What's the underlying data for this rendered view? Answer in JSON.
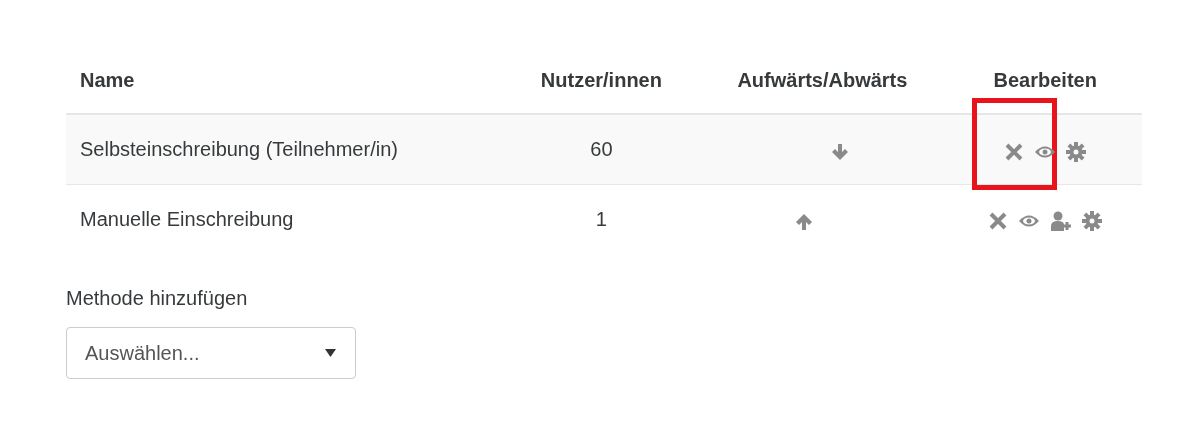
{
  "table": {
    "columns": [
      "Name",
      "Nutzer/innen",
      "Aufwärts/Abwärts",
      "Bearbeiten"
    ],
    "rows": [
      {
        "name": "Selbsteinschreibung (Teilnehmer/in)",
        "users": "60",
        "moves": [
          {
            "kind": "down"
          }
        ],
        "actions": [
          {
            "kind": "delete",
            "highlighted": true
          },
          {
            "kind": "visibility",
            "highlighted": false
          },
          {
            "kind": "settings",
            "highlighted": false
          }
        ]
      },
      {
        "name": "Manuelle Einschreibung",
        "users": "1",
        "moves": [
          {
            "kind": "up"
          }
        ],
        "actions": [
          {
            "kind": "delete",
            "highlighted": false
          },
          {
            "kind": "visibility",
            "highlighted": false
          },
          {
            "kind": "enrol",
            "highlighted": false
          },
          {
            "kind": "settings",
            "highlighted": false
          }
        ]
      }
    ]
  },
  "add_method": {
    "label": "Methode hinzufügen",
    "select_value": "Auswählen..."
  }
}
